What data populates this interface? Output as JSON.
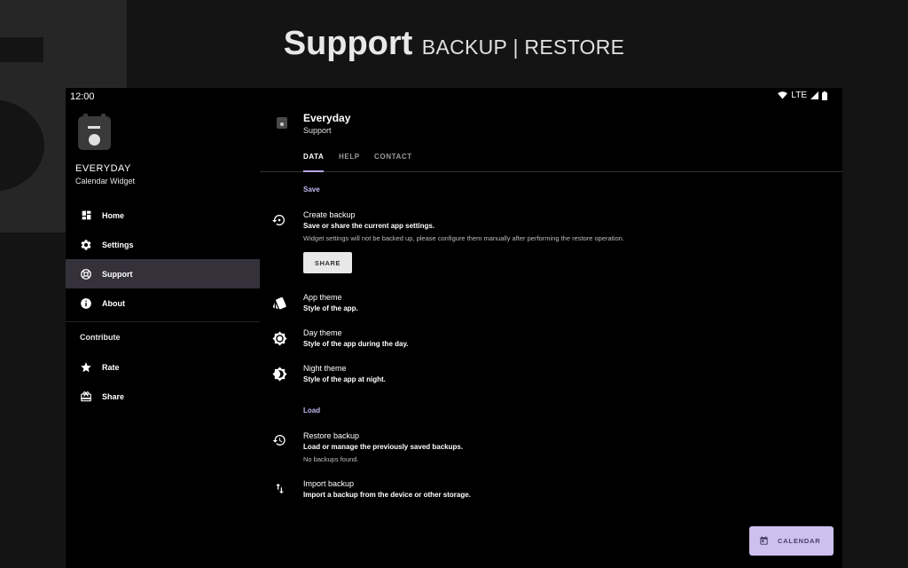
{
  "promo": {
    "title": "Support",
    "subtitle": "BACKUP | RESTORE"
  },
  "status_bar": {
    "time": "12:00",
    "network": "LTE"
  },
  "drawer": {
    "app_name": "EVERYDAY",
    "app_subtitle": "Calendar Widget",
    "items": [
      {
        "label": "Home",
        "icon": "dashboard-icon",
        "active": false
      },
      {
        "label": "Settings",
        "icon": "gear-icon",
        "active": false
      },
      {
        "label": "Support",
        "icon": "lifebuoy-icon",
        "active": true
      },
      {
        "label": "About",
        "icon": "info-icon",
        "active": false
      }
    ],
    "section_label": "Contribute",
    "contribute_items": [
      {
        "label": "Rate",
        "icon": "star-icon"
      },
      {
        "label": "Share",
        "icon": "gift-icon"
      }
    ]
  },
  "header": {
    "title": "Everyday",
    "subtitle": "Support"
  },
  "tabs": [
    {
      "label": "DATA",
      "active": true
    },
    {
      "label": "HELP",
      "active": false
    },
    {
      "label": "CONTACT",
      "active": false
    }
  ],
  "save_section": {
    "label": "Save",
    "create_backup": {
      "title": "Create backup",
      "subtitle": "Save or share the current app settings.",
      "note": "Widget settings will not be backed up, please configure them manually after performing the restore operation.",
      "button": "SHARE"
    },
    "app_theme": {
      "title": "App theme",
      "subtitle": "Style of the app."
    },
    "day_theme": {
      "title": "Day theme",
      "subtitle": "Style of the app during the day."
    },
    "night_theme": {
      "title": "Night theme",
      "subtitle": "Style of the app at night."
    }
  },
  "load_section": {
    "label": "Load",
    "restore_backup": {
      "title": "Restore backup",
      "subtitle": "Load or manage the previously saved backups.",
      "note": "No backups found."
    },
    "import_backup": {
      "title": "Import backup",
      "subtitle": "Import a backup from the device or other storage."
    }
  },
  "fab": {
    "label": "CALENDAR"
  },
  "colors": {
    "accent": "#c5b8ef",
    "fab": "#cdc0ee",
    "active_item": "#35313b",
    "background": "#000000"
  }
}
